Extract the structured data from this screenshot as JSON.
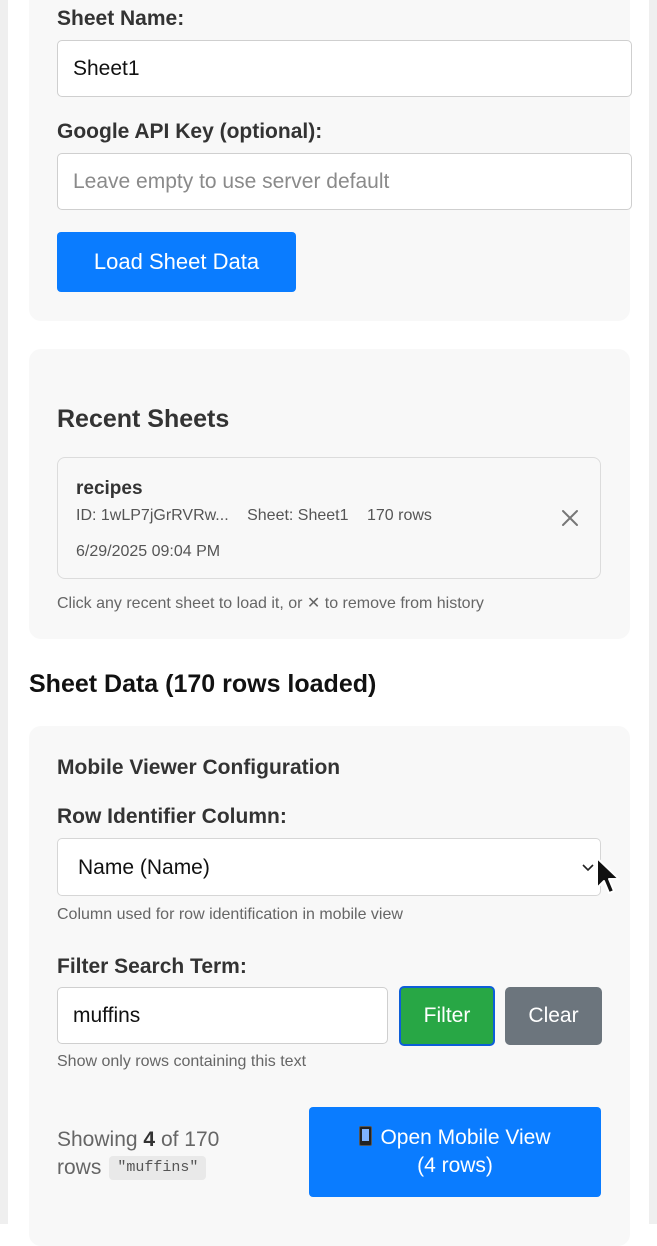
{
  "sheet_form": {
    "sheet_name_label": "Sheet Name:",
    "sheet_name_value": "Sheet1",
    "api_key_label": "Google API Key (optional):",
    "api_key_value": "",
    "api_key_placeholder": "Leave empty to use server default",
    "load_button": "Load Sheet Data"
  },
  "recent": {
    "title": "Recent Sheets",
    "items": [
      {
        "name": "recipes",
        "id": "ID: 1wLP7jGrRVRw...",
        "sheet": "Sheet: Sheet1",
        "rows": "170 rows",
        "date": "6/29/2025 09:04 PM",
        "remove_icon": "close-icon"
      }
    ],
    "hint": "Click any recent sheet to load it, or ✕ to remove from history"
  },
  "data": {
    "heading": "Sheet Data (170 rows loaded)",
    "config": {
      "title": "Mobile Viewer Configuration",
      "row_id_label": "Row Identifier Column:",
      "row_id_value": "Name (Name)",
      "row_id_hint": "Column used for row identification in mobile view",
      "filter_label": "Filter Search Term:",
      "filter_value": "muffins",
      "filter_button": "Filter",
      "clear_button": "Clear",
      "filter_hint": "Show only rows containing this text"
    },
    "summary": {
      "showing_prefix": "Showing",
      "shown_count": "4",
      "of_total": "of 170",
      "rows_word": "rows",
      "term_badge": "\"muffins\""
    },
    "mobile_button": {
      "line1": "Open Mobile View",
      "line2": "(4 rows)",
      "icon": "mobile-phone-icon"
    }
  },
  "colors": {
    "primary": "#0a7cff",
    "filter_green": "#28a745",
    "clear_gray": "#6c757d",
    "panel_bg": "#f8f8f8"
  }
}
